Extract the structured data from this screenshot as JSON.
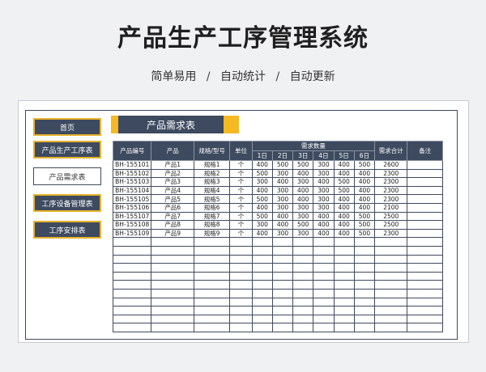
{
  "header": {
    "title": "产品生产工序管理系统",
    "subtitle_parts": [
      "简单易用",
      "自动统计",
      "自动更新"
    ],
    "separator": "/"
  },
  "nav": {
    "items": [
      {
        "label": "首页",
        "style": "dark"
      },
      {
        "label": "产品生产工序表",
        "style": "dark"
      },
      {
        "label": "产品需求表",
        "style": "light"
      },
      {
        "label": "工序设备管理表",
        "style": "dark"
      },
      {
        "label": "工序安排表",
        "style": "dark"
      }
    ]
  },
  "sheet": {
    "title": "产品需求表"
  },
  "table": {
    "headers": {
      "code": "产品编号",
      "product": "产品",
      "spec": "规格/型号",
      "unit": "单位",
      "demand_group": "需求数量",
      "days": [
        "1日",
        "2日",
        "3日",
        "4日",
        "5日",
        "6日"
      ],
      "total": "需求合计",
      "note": "备注"
    },
    "rows": [
      [
        "BH-155101",
        "产品1",
        "规格1",
        "个",
        "400",
        "500",
        "500",
        "300",
        "400",
        "500",
        "2600",
        ""
      ],
      [
        "BH-155102",
        "产品2",
        "规格2",
        "个",
        "500",
        "300",
        "400",
        "300",
        "400",
        "400",
        "2300",
        ""
      ],
      [
        "BH-155103",
        "产品3",
        "规格3",
        "个",
        "300",
        "400",
        "300",
        "400",
        "500",
        "400",
        "2300",
        ""
      ],
      [
        "BH-155104",
        "产品4",
        "规格4",
        "个",
        "400",
        "300",
        "400",
        "300",
        "500",
        "400",
        "2300",
        ""
      ],
      [
        "BH-155105",
        "产品5",
        "规格5",
        "个",
        "500",
        "300",
        "400",
        "300",
        "400",
        "400",
        "2300",
        ""
      ],
      [
        "BH-155106",
        "产品6",
        "规格6",
        "个",
        "400",
        "300",
        "300",
        "300",
        "400",
        "400",
        "2100",
        ""
      ],
      [
        "BH-155107",
        "产品7",
        "规格7",
        "个",
        "500",
        "400",
        "300",
        "400",
        "400",
        "500",
        "2500",
        ""
      ],
      [
        "BH-155108",
        "产品8",
        "规格8",
        "个",
        "300",
        "400",
        "500",
        "400",
        "400",
        "500",
        "2500",
        ""
      ],
      [
        "BH-155109",
        "产品9",
        "规格9",
        "个",
        "400",
        "300",
        "300",
        "400",
        "400",
        "500",
        "2300",
        ""
      ]
    ],
    "blank_row_count": 11
  },
  "colors": {
    "dark_navy": "#3d4a5f",
    "accent_yellow": "#f5b921"
  }
}
